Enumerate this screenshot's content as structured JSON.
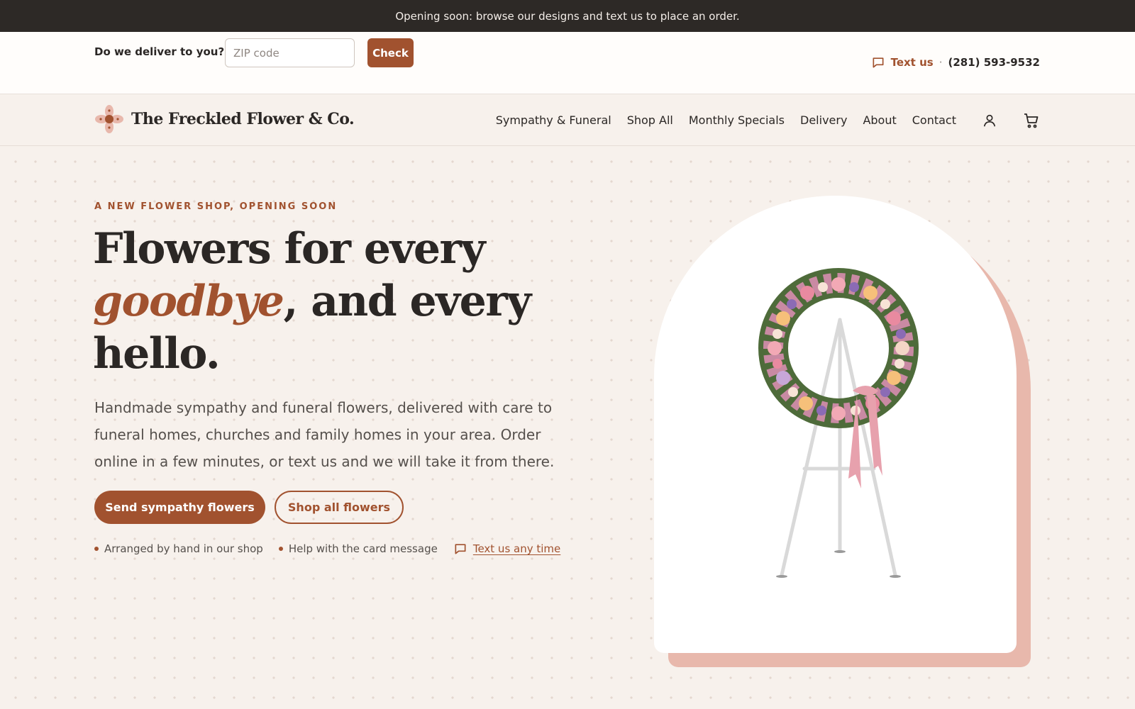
{
  "announcement": "Opening soon: browse our designs and text us to place an order.",
  "utility": {
    "deliver_label": "Do we deliver to you?",
    "zip_placeholder": "ZIP code",
    "zip_value": "",
    "check_label": "Check",
    "text_us": "Text us",
    "separator": "·",
    "phone": "(281) 593-9532"
  },
  "brand": {
    "name": "The Freckled Flower & Co.",
    "logo_icon": "flower-logo-icon"
  },
  "nav": {
    "items": [
      "Sympathy & Funeral",
      "Shop All",
      "Monthly Specials",
      "Delivery",
      "About",
      "Contact"
    ],
    "account_icon": "user-icon",
    "cart_icon": "cart-icon"
  },
  "hero": {
    "eyebrow": "A NEW FLOWER SHOP, OPENING SOON",
    "headline_part1": "Flowers for every",
    "headline_accent": "goodbye",
    "headline_part2": ", and every hello.",
    "subhead": "Handmade sympathy and funeral flowers, delivered with care to funeral homes, churches and family homes in your area. Order online in a few minutes, or text us and we will take it from there.",
    "primary_cta": "Send sympathy flowers",
    "secondary_cta": "Shop all flowers",
    "features": [
      "Arranged by hand in our shop",
      "Help with the card message"
    ],
    "text_link": "Text us any time",
    "image_alt": "wreath-on-easel"
  },
  "colors": {
    "accent": "#a1522f",
    "dark": "#2d2926",
    "background": "#f7f1ec",
    "arch_shadow": "#e8b8ac"
  }
}
